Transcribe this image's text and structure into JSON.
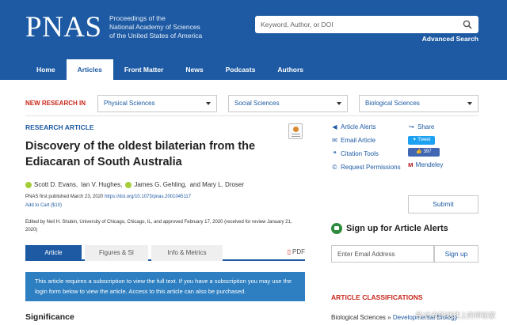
{
  "header": {
    "logo": "PNAS",
    "subtitle_lines": [
      "Proceedings of the",
      "National Academy of Sciences",
      "of the United States of America"
    ],
    "search_placeholder": "Keyword, Author, or DOI",
    "advanced_search": "Advanced Search"
  },
  "nav": {
    "items": [
      {
        "label": "Home",
        "active": false
      },
      {
        "label": "Articles",
        "active": true
      },
      {
        "label": "Front Matter",
        "active": false
      },
      {
        "label": "News",
        "active": false
      },
      {
        "label": "Podcasts",
        "active": false
      },
      {
        "label": "Authors",
        "active": false
      }
    ]
  },
  "new_research": {
    "label": "NEW RESEARCH IN",
    "dropdowns": [
      "Physical Sciences",
      "Social Sciences",
      "Biological Sciences"
    ]
  },
  "article": {
    "type": "RESEARCH ARTICLE",
    "title": "Discovery of the oldest bilaterian from the Ediacaran of South Australia",
    "authors": {
      "a1": "Scott D. Evans,",
      "a2": "Ian V. Hughes,",
      "a3": "James G. Gehling,",
      "a4": "and Mary L. Droser"
    },
    "pub_line_prefix": "PNAS first published March 23, 2020",
    "doi": "https://doi.org/10.1073/pnas.2001045117",
    "add_to_cart": "Add to Cart ($10)",
    "edited_by": "Edited by Neil H. Shubin, University of Chicago, Chicago, IL, and approved February 17, 2020 (received for review January 21, 2020)"
  },
  "tabs": {
    "article": "Article",
    "figures": "Figures & SI",
    "info": "Info & Metrics",
    "pdf": "PDF"
  },
  "notice": "This article requires a subscription to view the full text. If you have a subscription you may use the login form below to view the article. Access to this article can also be purchased.",
  "significance": "Significance",
  "tools": {
    "alerts": "Article Alerts",
    "email": "Email Article",
    "citation": "Citation Tools",
    "permissions": "Request Permissions",
    "share": "Share",
    "tweet": "Tweet",
    "like": "397",
    "mendeley": "Mendeley",
    "submit": "Submit"
  },
  "signup": {
    "heading": "Sign up for Article Alerts",
    "email_placeholder": "Enter Email Address",
    "button": "Sign up"
  },
  "classifications": {
    "heading": "ARTICLE CLASSIFICATIONS",
    "category": "Biological Sciences",
    "separator": "»",
    "sub": "Developmental Biology"
  },
  "watermark": "号/古老的地球上的神秘家",
  "colors": {
    "brand_blue": "#1d5aa3",
    "accent_red": "#c8261b",
    "notice_blue": "#2d7fc1"
  }
}
